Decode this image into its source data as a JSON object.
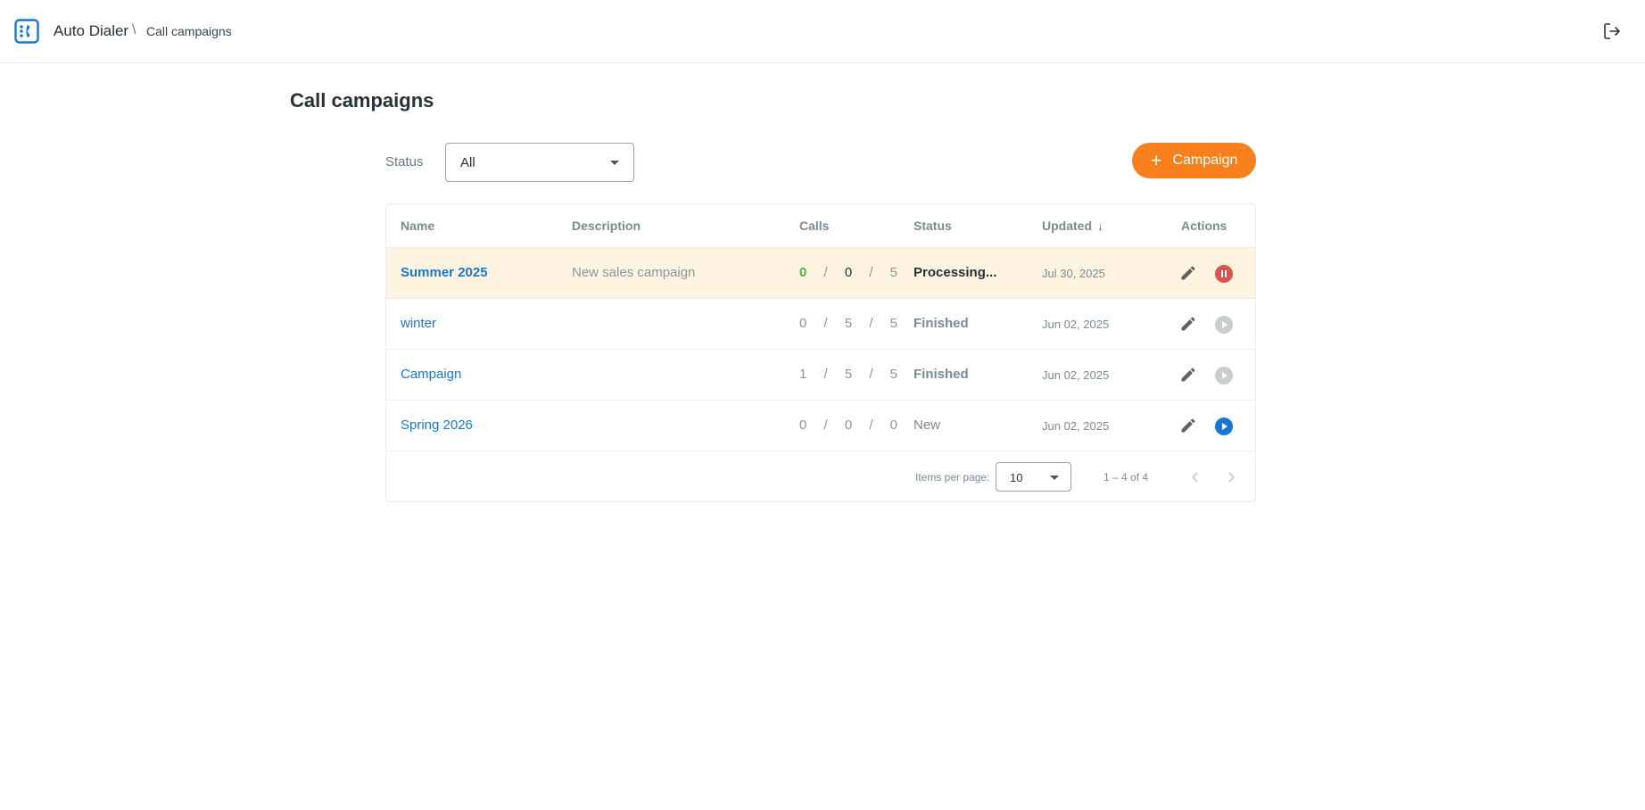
{
  "header": {
    "app_name": "Auto Dialer",
    "breadcrumb_separator": "\\",
    "breadcrumb_current": "Call campaigns"
  },
  "page": {
    "title": "Call campaigns"
  },
  "filter": {
    "label": "Status",
    "selected": "All"
  },
  "add_button": {
    "plus": "+",
    "label": "Campaign"
  },
  "table": {
    "columns": {
      "name": "Name",
      "description": "Description",
      "calls": "Calls",
      "status": "Status",
      "updated": "Updated",
      "actions": "Actions"
    },
    "sort_indicator": "↓",
    "calls_separator": "/",
    "rows": [
      {
        "name": "Summer 2025",
        "description": "New sales campaign",
        "calls": [
          "0",
          "0",
          "5"
        ],
        "status": "Processing...",
        "updated": "Jul 30, 2025",
        "action": "pause"
      },
      {
        "name": "winter",
        "description": "",
        "calls": [
          "0",
          "5",
          "5"
        ],
        "status": "Finished",
        "updated": "Jun 02, 2025",
        "action": "play-disabled"
      },
      {
        "name": "Campaign",
        "description": "",
        "calls": [
          "1",
          "5",
          "5"
        ],
        "status": "Finished",
        "updated": "Jun 02, 2025",
        "action": "play-disabled"
      },
      {
        "name": "Spring 2026",
        "description": "",
        "calls": [
          "0",
          "0",
          "0"
        ],
        "status": "New",
        "updated": "Jun 02, 2025",
        "action": "play"
      }
    ]
  },
  "paginator": {
    "items_per_page_label": "Items per page:",
    "items_per_page": "10",
    "range": "1 – 4 of 4"
  },
  "colors": {
    "accent_orange": "#f7801c",
    "link_blue": "#1976d2",
    "highlight_row": "#fff4e2",
    "pause_red": "#d9534f",
    "success_green": "#4caf50"
  },
  "icons": {
    "logo": "phone-book-icon",
    "logout": "logout-icon",
    "edit": "pencil-icon",
    "pause": "pause-circle-icon",
    "play": "play-circle-icon",
    "prev": "chevron-left-icon",
    "next": "chevron-right-icon"
  }
}
